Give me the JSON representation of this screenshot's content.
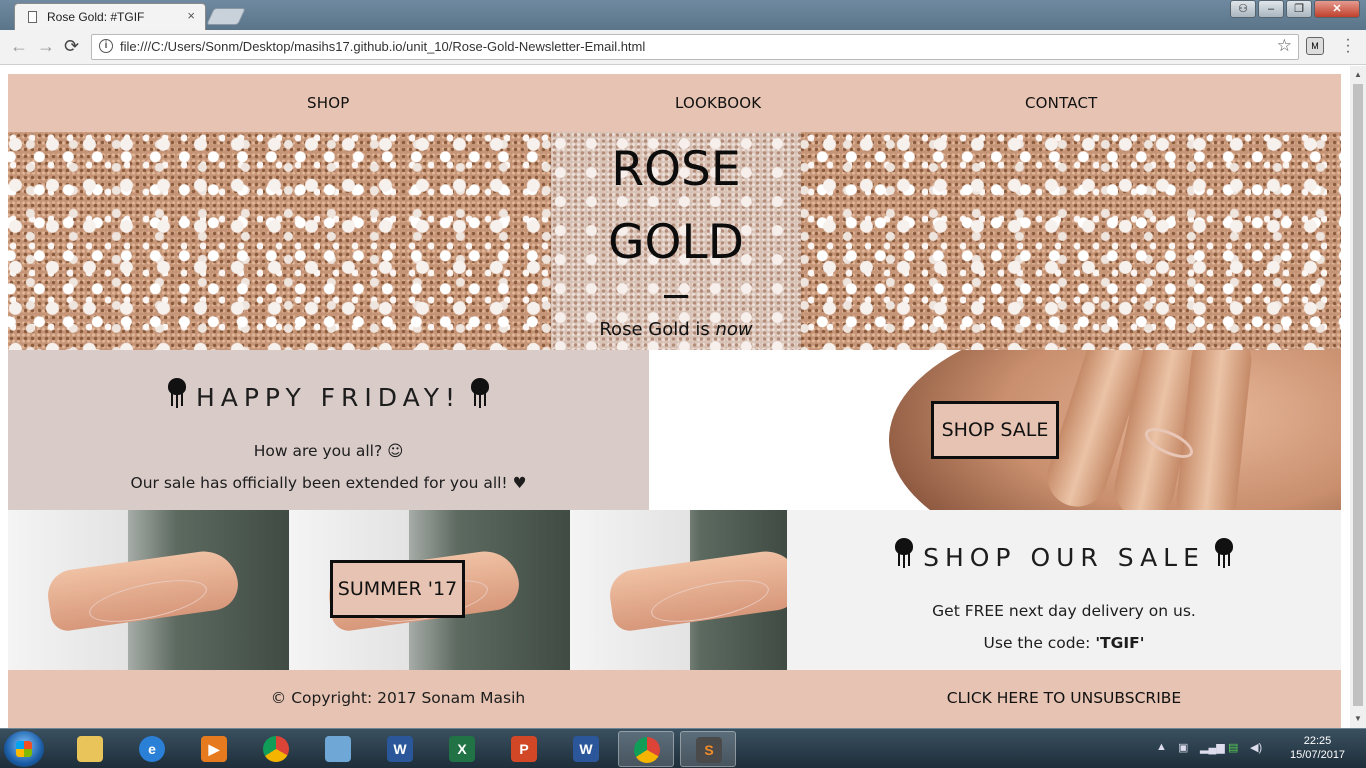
{
  "browser": {
    "tab_title": "Rose Gold: #TGIF",
    "tab_close": "×",
    "url": "file:///C:/Users/Sonm/Desktop/masihs17.github.io/unit_10/Rose-Gold-Newsletter-Email.html",
    "back": "←",
    "forward": "→",
    "reload": "⟳",
    "star": "☆",
    "info": "i",
    "window_buttons": {
      "user": "⚇",
      "minimize": "‒",
      "maximize": "❐",
      "close": "✕"
    }
  },
  "nav": {
    "shop": "SHOP",
    "lookbook": "LOOKBOOK",
    "contact": "CONTACT"
  },
  "hero": {
    "title_line1": "ROSE",
    "title_line2": "GOLD",
    "subtitle_text": "Rose Gold is",
    "subtitle_emph": "now"
  },
  "friday": {
    "heading": "HAPPY FRIDAY!",
    "line1": "How are you all? ☺",
    "line2": "Our sale has officially been extended for you all! ♥"
  },
  "shop_sale_button": "SHOP SALE",
  "summer_button": "SUMMER '17",
  "sale": {
    "heading": "SHOP OUR SALE",
    "line1": "Get FREE next day delivery on us.",
    "line2_prefix": "Use the code: ",
    "code": "'TGIF'"
  },
  "footer": {
    "copyright": "© Copyright: 2017 Sonam Masih",
    "unsubscribe": "CLICK HERE TO UNSUBSCRIBE"
  },
  "taskbar": {
    "apps": [
      "file-explorer",
      "internet-explorer",
      "media-player",
      "chrome",
      "image-viewer",
      "word",
      "excel",
      "powerpoint",
      "word-2",
      "chrome-active",
      "sublime-text"
    ],
    "time": "22:25",
    "date": "15/07/2017"
  },
  "colors": {
    "rose_gold": "#e6c3b2",
    "friday_bg": "#d8cbc8",
    "sale_bg": "#f2f2f2"
  }
}
